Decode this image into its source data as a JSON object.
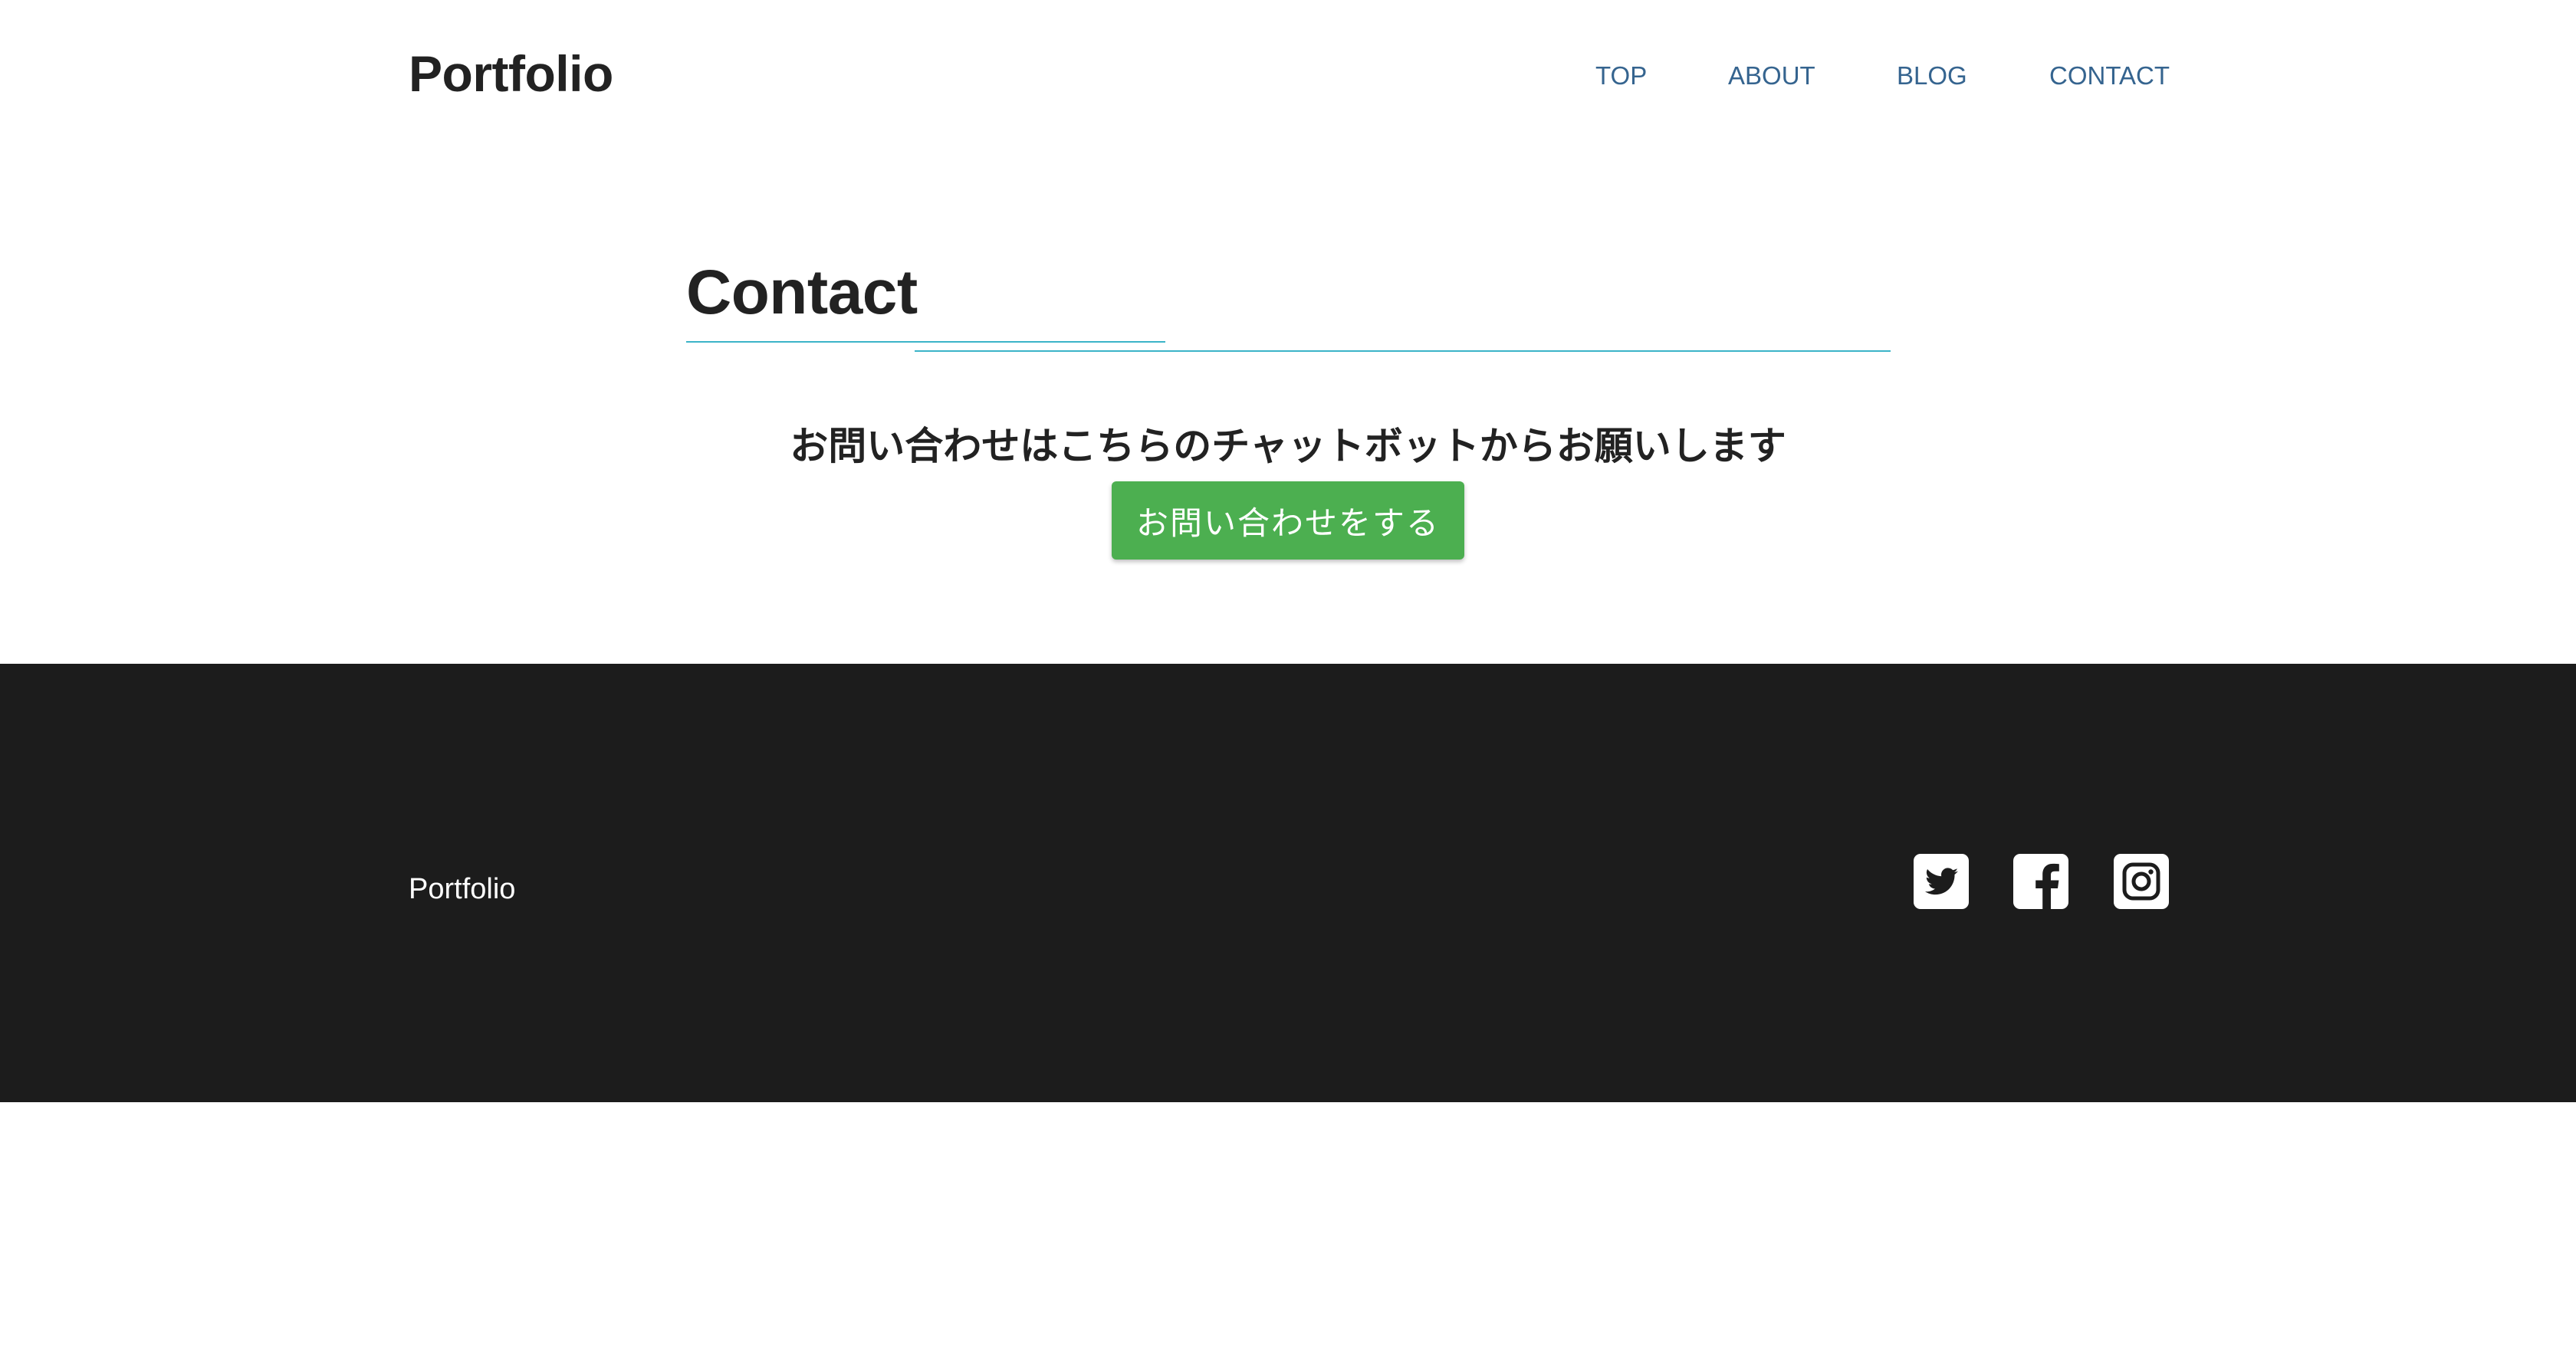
{
  "header": {
    "logo": "Portfolio",
    "nav": [
      {
        "label": "TOP"
      },
      {
        "label": "ABOUT"
      },
      {
        "label": "BLOG"
      },
      {
        "label": "CONTACT"
      }
    ]
  },
  "main": {
    "title": "Contact",
    "message": "お問い合わせはこちらのチャットボットからお願いします",
    "button_label": "お問い合わせをする"
  },
  "footer": {
    "logo": "Portfolio",
    "social_icons": [
      "twitter-icon",
      "facebook-icon",
      "instagram-icon"
    ]
  },
  "colors": {
    "nav_text": "#35648f",
    "accent_line": "#3bb4c8",
    "button_bg": "#4caf50",
    "footer_bg": "#1c1c1c",
    "heading_text": "#222222"
  }
}
